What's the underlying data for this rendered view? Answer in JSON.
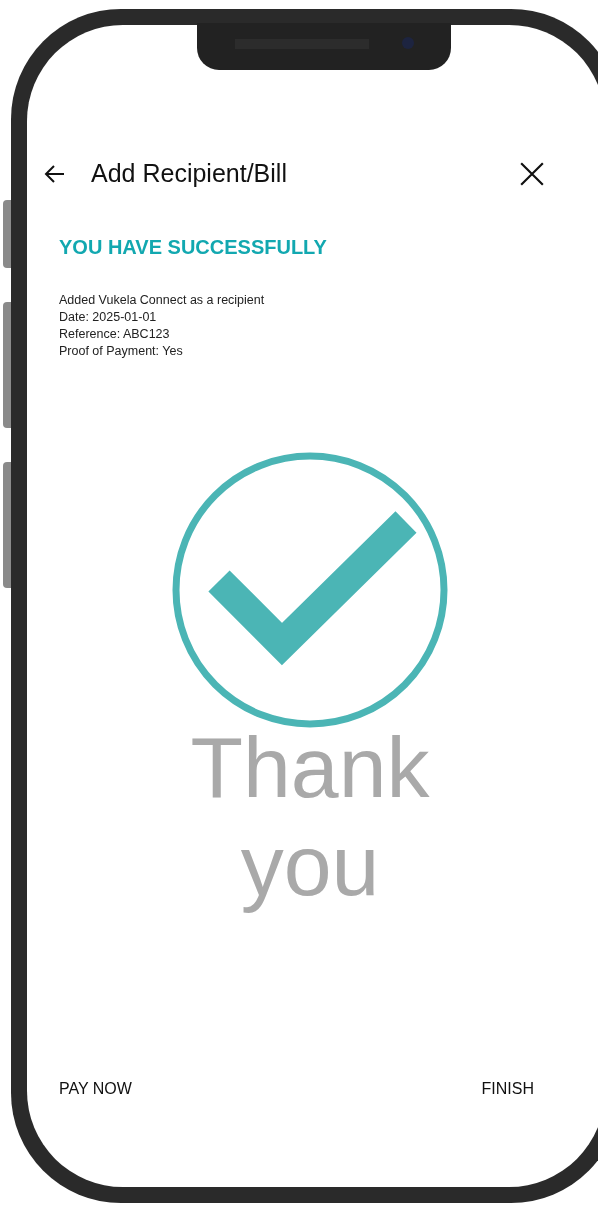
{
  "header": {
    "title": "Add Recipient/Bill"
  },
  "heading": "YOU HAVE SUCCESSFULLY",
  "details": [
    "Added Vukela Connect as a recipient",
    "Date: 2025-01-01",
    "Reference: ABC123",
    "Proof of Payment: Yes"
  ],
  "message": "Thank you",
  "actions": [
    "PAY NOW",
    "FINISH"
  ]
}
